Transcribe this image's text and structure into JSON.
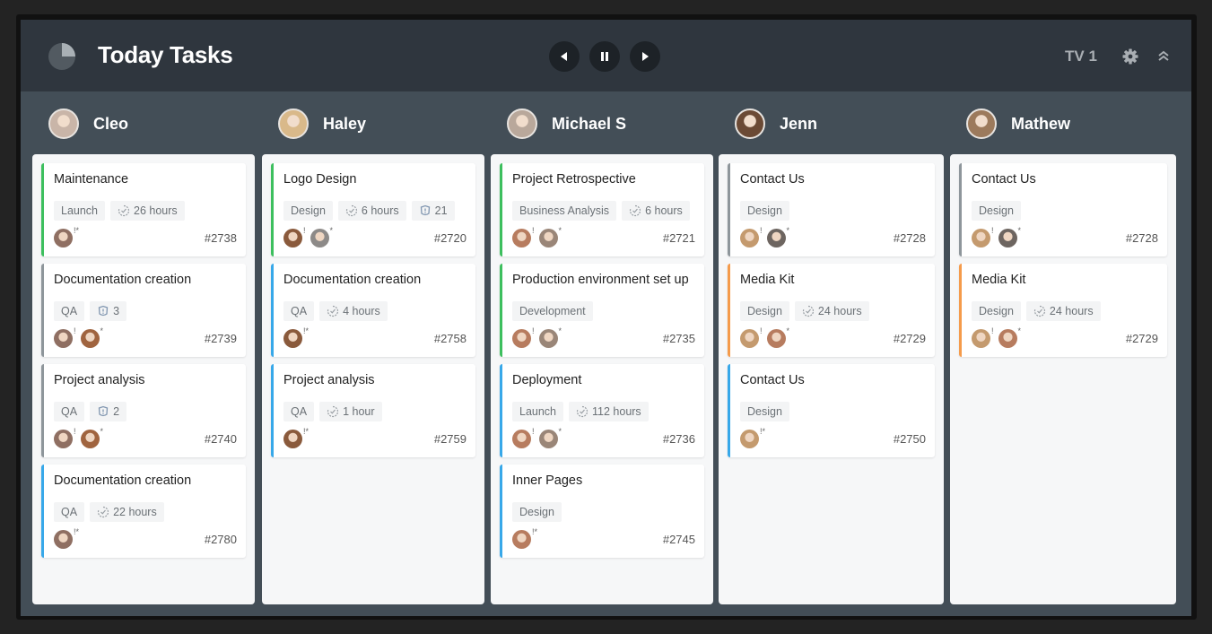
{
  "header": {
    "title": "Today Tasks",
    "screen_label": "TV 1",
    "controls": {
      "prev": "previous-icon",
      "pause": "pause-icon",
      "next": "next-icon"
    },
    "icons": {
      "logo": "pie-chart-icon",
      "settings": "gear-icon",
      "collapse": "chevron-double-up-icon"
    }
  },
  "colors": {
    "status_green": "#3dbf5e",
    "status_blue": "#37a8e9",
    "status_orange": "#f59b4b",
    "status_gray": "#8e969b",
    "topbar": "#2f363e",
    "board_bg": "#434e57"
  },
  "columns": [
    {
      "name": "Cleo",
      "avatar_color": "#c9b5a8",
      "cards": [
        {
          "title": "Maintenance",
          "status": "green",
          "tags": [
            {
              "type": "label",
              "text": "Launch"
            },
            {
              "type": "time",
              "text": "26 hours"
            }
          ],
          "assignees": [
            {
              "color": "#8f6f62",
              "mark": "!*"
            }
          ],
          "id": "#2738"
        },
        {
          "title": "Documentation creation",
          "status": "gray",
          "tags": [
            {
              "type": "label",
              "text": "QA"
            },
            {
              "type": "badge",
              "text": "3"
            }
          ],
          "assignees": [
            {
              "color": "#8f6f62",
              "mark": "!"
            },
            {
              "color": "#a0643f",
              "mark": "*"
            }
          ],
          "id": "#2739"
        },
        {
          "title": "Project analysis",
          "status": "gray",
          "tags": [
            {
              "type": "label",
              "text": "QA"
            },
            {
              "type": "badge",
              "text": "2"
            }
          ],
          "assignees": [
            {
              "color": "#8f6f62",
              "mark": "!"
            },
            {
              "color": "#a0643f",
              "mark": "*"
            }
          ],
          "id": "#2740"
        },
        {
          "title": "Documentation creation",
          "status": "blue",
          "tags": [
            {
              "type": "label",
              "text": "QA"
            },
            {
              "type": "time",
              "text": "22 hours"
            }
          ],
          "assignees": [
            {
              "color": "#8f6f62",
              "mark": "!*"
            }
          ],
          "id": "#2780"
        }
      ]
    },
    {
      "name": "Haley",
      "avatar_color": "#d9b98a",
      "cards": [
        {
          "title": "Logo Design",
          "status": "green",
          "tags": [
            {
              "type": "label",
              "text": "Design"
            },
            {
              "type": "time",
              "text": "6 hours"
            },
            {
              "type": "badge",
              "text": "21"
            }
          ],
          "assignees": [
            {
              "color": "#8a5a3c",
              "mark": "!"
            },
            {
              "color": "#8d8a88",
              "mark": "*"
            }
          ],
          "id": "#2720"
        },
        {
          "title": "Documentation creation",
          "status": "blue",
          "tags": [
            {
              "type": "label",
              "text": "QA"
            },
            {
              "type": "time",
              "text": "4 hours"
            }
          ],
          "assignees": [
            {
              "color": "#8a5a3c",
              "mark": "!*"
            }
          ],
          "id": "#2758"
        },
        {
          "title": "Project analysis",
          "status": "blue",
          "tags": [
            {
              "type": "label",
              "text": "QA"
            },
            {
              "type": "time",
              "text": "1 hour"
            }
          ],
          "assignees": [
            {
              "color": "#8a5a3c",
              "mark": "!*"
            }
          ],
          "id": "#2759"
        }
      ]
    },
    {
      "name": "Michael S",
      "avatar_color": "#b9a89b",
      "cards": [
        {
          "title": "Project Retrospective",
          "status": "green",
          "tags": [
            {
              "type": "label",
              "text": "Business Analysis"
            },
            {
              "type": "time",
              "text": "6 hours"
            }
          ],
          "assignees": [
            {
              "color": "#b77c5f",
              "mark": "!"
            },
            {
              "color": "#9a8678",
              "mark": "*"
            }
          ],
          "id": "#2721"
        },
        {
          "title": "Production environment set up",
          "status": "green",
          "tags": [
            {
              "type": "label",
              "text": "Development"
            }
          ],
          "assignees": [
            {
              "color": "#b77c5f",
              "mark": "!"
            },
            {
              "color": "#9a8678",
              "mark": "*"
            }
          ],
          "id": "#2735"
        },
        {
          "title": "Deployment",
          "status": "blue",
          "tags": [
            {
              "type": "label",
              "text": "Launch"
            },
            {
              "type": "time",
              "text": "112 hours"
            }
          ],
          "assignees": [
            {
              "color": "#b77c5f",
              "mark": "!"
            },
            {
              "color": "#9a8678",
              "mark": "*"
            }
          ],
          "id": "#2736"
        },
        {
          "title": "Inner Pages",
          "status": "blue",
          "tags": [
            {
              "type": "label",
              "text": "Design"
            }
          ],
          "assignees": [
            {
              "color": "#b77c5f",
              "mark": "!*"
            }
          ],
          "id": "#2745"
        }
      ]
    },
    {
      "name": "Jenn",
      "avatar_color": "#6b4a35",
      "cards": [
        {
          "title": "Contact Us",
          "status": "gray",
          "tags": [
            {
              "type": "label",
              "text": "Design"
            }
          ],
          "assignees": [
            {
              "color": "#c49a6e",
              "mark": "!"
            },
            {
              "color": "#6d6560",
              "mark": "*"
            }
          ],
          "id": "#2728"
        },
        {
          "title": "Media Kit",
          "status": "orange",
          "tags": [
            {
              "type": "label",
              "text": "Design"
            },
            {
              "type": "time",
              "text": "24 hours"
            }
          ],
          "assignees": [
            {
              "color": "#c49a6e",
              "mark": "!"
            },
            {
              "color": "#b77c5f",
              "mark": "*"
            }
          ],
          "id": "#2729"
        },
        {
          "title": "Contact Us",
          "status": "blue",
          "tags": [
            {
              "type": "label",
              "text": "Design"
            }
          ],
          "assignees": [
            {
              "color": "#c49a6e",
              "mark": "!*"
            }
          ],
          "id": "#2750"
        }
      ]
    },
    {
      "name": "Mathew",
      "avatar_color": "#9c7a5c",
      "cards": [
        {
          "title": "Contact Us",
          "status": "gray",
          "tags": [
            {
              "type": "label",
              "text": "Design"
            }
          ],
          "assignees": [
            {
              "color": "#c49a6e",
              "mark": "!"
            },
            {
              "color": "#6d6560",
              "mark": "*"
            }
          ],
          "id": "#2728"
        },
        {
          "title": "Media Kit",
          "status": "orange",
          "tags": [
            {
              "type": "label",
              "text": "Design"
            },
            {
              "type": "time",
              "text": "24 hours"
            }
          ],
          "assignees": [
            {
              "color": "#c49a6e",
              "mark": "!"
            },
            {
              "color": "#b77c5f",
              "mark": "*"
            }
          ],
          "id": "#2729"
        }
      ]
    }
  ]
}
